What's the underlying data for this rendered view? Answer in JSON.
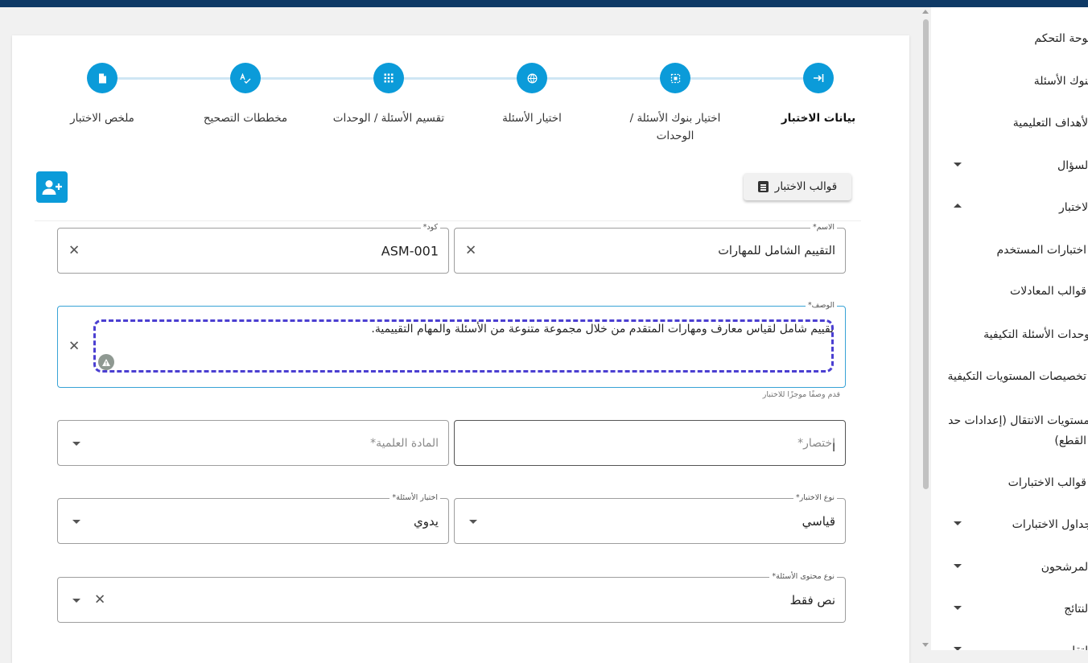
{
  "stepper": {
    "steps": [
      {
        "label": "بيانات الاختبار",
        "icon": "arrow-right-to-bar-icon"
      },
      {
        "label": "اختيار بنوك الأسئلة / الوحدات",
        "icon": "bank-select-icon"
      },
      {
        "label": "اختيار الأسئلة",
        "icon": "globe-icon"
      },
      {
        "label": "تقسيم الأسئلة / الوحدات",
        "icon": "grid-icon"
      },
      {
        "label": "مخططات التصحيح",
        "icon": "spellcheck-icon"
      },
      {
        "label": "ملخص الاختبار",
        "icon": "document-icon"
      }
    ],
    "active_index": 0
  },
  "toolbar": {
    "templates_label": "قوالب الاختبار",
    "add_user_icon": "person-add-icon"
  },
  "form": {
    "name": {
      "label": "الاسم*",
      "value": "التقييم الشامل للمهارات"
    },
    "code": {
      "label": "كود*",
      "value": "ASM-001"
    },
    "description": {
      "label": "الوصف*",
      "value": "تقييم شامل لقياس معارف ومهارات المتقدم من خلال مجموعة متنوعة من الأسئلة والمهام التقييمية.",
      "hint": "قدم وصفًا موجزًا للاختبار"
    },
    "abbreviation": {
      "placeholder": "اختصار*",
      "value": "ا"
    },
    "subject": {
      "placeholder": "المادة العلمية*"
    },
    "exam_type": {
      "label": "نوع الاختبار*",
      "value": "قياسي"
    },
    "question_selection": {
      "label": "اختيار الأسئلة*",
      "value": "يدوي"
    },
    "content_type": {
      "label": "نوع محتوى الأسئلة*",
      "value": "نص فقط"
    }
  },
  "sidebar": {
    "items": [
      {
        "label": "لوحة التحكم",
        "caret": ""
      },
      {
        "label": "بنوك الأسئلة",
        "caret": ""
      },
      {
        "label": "الأهداف التعليمية",
        "caret": ""
      },
      {
        "label": "السؤال",
        "caret": "down"
      },
      {
        "label": "الاختبار",
        "caret": "up"
      },
      {
        "label": "اختبارات المستخدم",
        "caret": ""
      },
      {
        "label": "قوالب المعادلات",
        "caret": ""
      },
      {
        "label": "وحدات الأسئلة التكيفية",
        "caret": ""
      },
      {
        "label": "تخصيصات المستويات التكيفية",
        "caret": ""
      },
      {
        "label": "مستويات الانتقال (إعدادات حد",
        "caret": ""
      },
      {
        "label": "القطع)",
        "caret": ""
      },
      {
        "label": "قوالب الاختبارات",
        "caret": ""
      },
      {
        "label": "جداول الاختبارات",
        "caret": "down"
      },
      {
        "label": "المرشحون",
        "caret": "down"
      },
      {
        "label": "النتائج",
        "caret": "down"
      },
      {
        "label": "التقارير",
        "caret": "down"
      }
    ]
  },
  "colors": {
    "accent": "#0b9bd9",
    "topbar": "#0f3a66",
    "dashed_highlight": "#4b3fd1"
  }
}
